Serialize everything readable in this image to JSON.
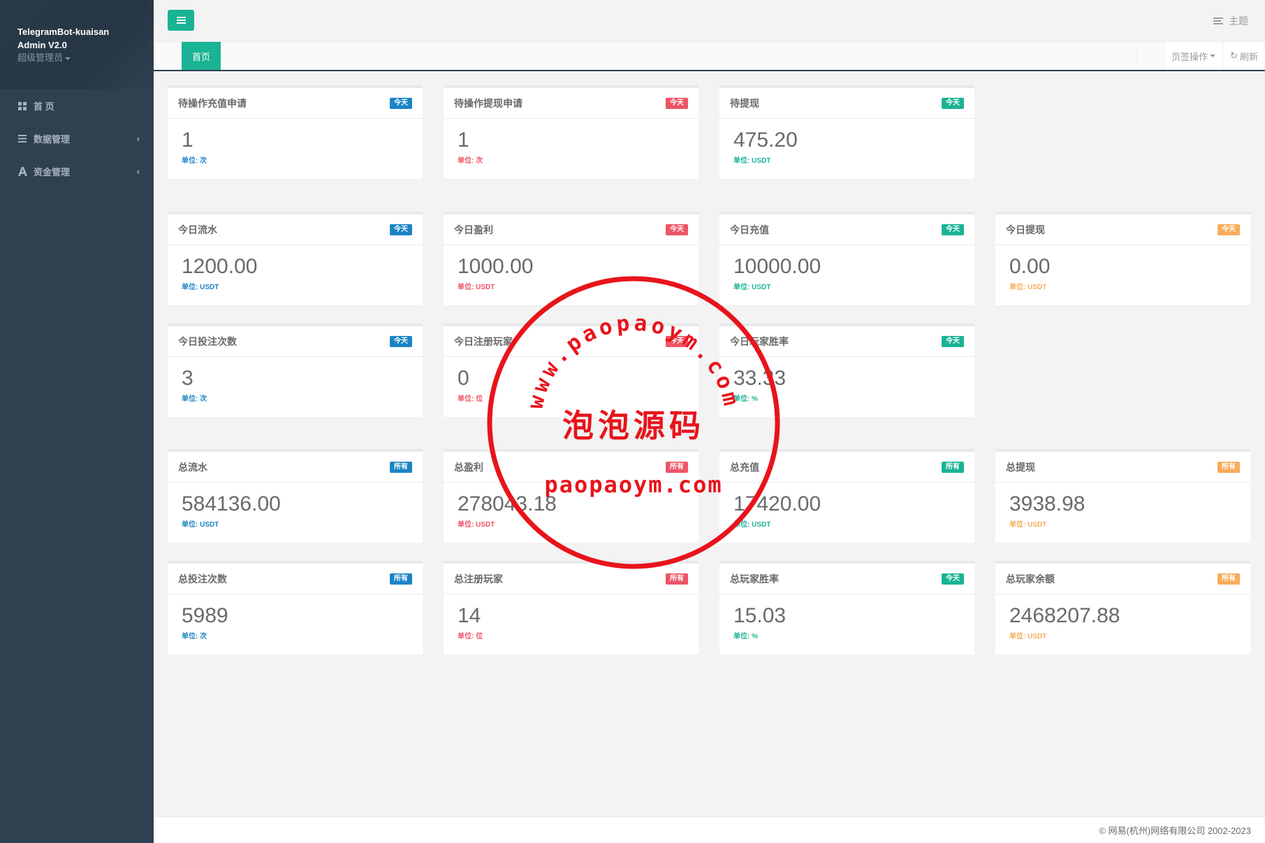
{
  "sidebar": {
    "app_title_line1": "TelegramBot-kuaisan",
    "app_title_line2": "Admin V2.0",
    "role": "超级管理员",
    "items": [
      {
        "label": "首 页",
        "icon": "grid-icon"
      },
      {
        "label": "数据管理",
        "icon": "list-icon"
      },
      {
        "label": "资金管理",
        "icon": "font-icon"
      }
    ]
  },
  "topbar": {
    "theme_label": "主题"
  },
  "tabs": {
    "home_label": "首页",
    "page_ops_label": "页签操作",
    "refresh_label": "刷新"
  },
  "cards": [
    {
      "title": "待操作充值申请",
      "badge": "今天",
      "value": "1",
      "unit": "单位: 次",
      "color": "blue"
    },
    {
      "title": "待操作提现申请",
      "badge": "今天",
      "value": "1",
      "unit": "单位: 次",
      "color": "red"
    },
    {
      "title": "待提现",
      "badge": "今天",
      "value": "475.20",
      "unit": "单位: USDT",
      "color": "green"
    },
    {
      "title": "今日流水",
      "badge": "今天",
      "value": "1200.00",
      "unit": "单位: USDT",
      "color": "blue"
    },
    {
      "title": "今日盈利",
      "badge": "今天",
      "value": "1000.00",
      "unit": "单位: USDT",
      "color": "red"
    },
    {
      "title": "今日充值",
      "badge": "今天",
      "value": "10000.00",
      "unit": "单位: USDT",
      "color": "green"
    },
    {
      "title": "今日提现",
      "badge": "今天",
      "value": "0.00",
      "unit": "单位: USDT",
      "color": "orange"
    },
    {
      "title": "今日投注次数",
      "badge": "今天",
      "value": "3",
      "unit": "单位: 次",
      "color": "blue"
    },
    {
      "title": "今日注册玩家",
      "badge": "今天",
      "value": "0",
      "unit": "单位: 位",
      "color": "red"
    },
    {
      "title": "今日玩家胜率",
      "badge": "今天",
      "value": "33.33",
      "unit": "单位: %",
      "color": "green"
    },
    {
      "title": "总流水",
      "badge": "所有",
      "value": "584136.00",
      "unit": "单位: USDT",
      "color": "blue"
    },
    {
      "title": "总盈利",
      "badge": "所有",
      "value": "278043.18",
      "unit": "单位: USDT",
      "color": "red"
    },
    {
      "title": "总充值",
      "badge": "所有",
      "value": "17420.00",
      "unit": "单位: USDT",
      "color": "green"
    },
    {
      "title": "总提现",
      "badge": "所有",
      "value": "3938.98",
      "unit": "单位: USDT",
      "color": "orange"
    },
    {
      "title": "总投注次数",
      "badge": "所有",
      "value": "5989",
      "unit": "单位: 次",
      "color": "blue"
    },
    {
      "title": "总注册玩家",
      "badge": "所有",
      "value": "14",
      "unit": "单位: 位",
      "color": "red"
    },
    {
      "title": "总玩家胜率",
      "badge": "今天",
      "value": "15.03",
      "unit": "单位: %",
      "color": "green"
    },
    {
      "title": "总玩家余额",
      "badge": "所有",
      "value": "2468207.88",
      "unit": "单位: USDT",
      "color": "orange"
    }
  ],
  "watermark": {
    "arc_text": "www.paopaoym.com",
    "center_text": "泡泡源码",
    "bottom_text": "paopaoym.com",
    "color": "#e8141b"
  },
  "footer": {
    "copyright": "© 网易(杭州)网络有限公司 2002-2023"
  },
  "colors": {
    "sidebar_bg": "#2f4050",
    "accent": "#1ab394",
    "blue": "#1c84c6",
    "red": "#ed5565",
    "orange": "#f8ac59"
  }
}
